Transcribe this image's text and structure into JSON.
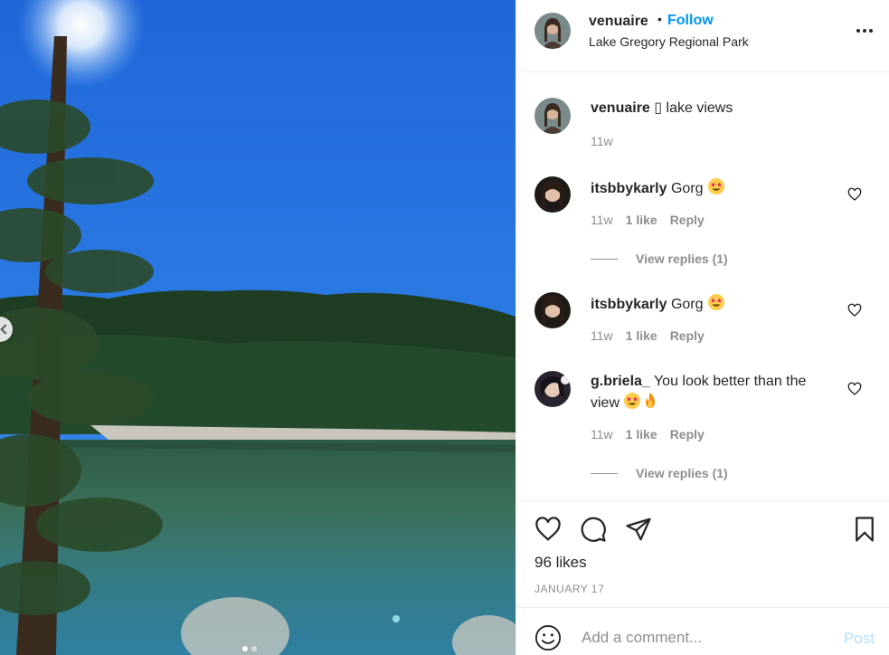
{
  "header": {
    "username": "venuaire",
    "dot": "•",
    "follow_label": "Follow",
    "location": "Lake Gregory Regional Park"
  },
  "caption": {
    "username": "venuaire",
    "emoji_glyph": "▯",
    "text": "lake views",
    "time": "11w"
  },
  "comments": [
    {
      "username": "itsbbykarly",
      "text": "Gorg",
      "emoji": "star-struck",
      "time": "11w",
      "likes": "1 like",
      "reply": "Reply",
      "view_replies": "View replies (1)"
    },
    {
      "username": "itsbbykarly",
      "text": "Gorg",
      "emoji": "star-struck",
      "time": "11w",
      "likes": "1 like",
      "reply": "Reply",
      "view_replies": ""
    },
    {
      "username": "g.briela_",
      "text": "You look better than the view",
      "emoji": "star-struck,fire",
      "time": "11w",
      "likes": "1 like",
      "reply": "Reply",
      "view_replies": "View replies (1)"
    }
  ],
  "actions": {
    "likes": "96 likes",
    "date": "JANUARY 17"
  },
  "add_comment": {
    "placeholder": "Add a comment...",
    "post_label": "Post"
  },
  "carousel": {
    "count": 2,
    "active": 0
  },
  "colors": {
    "accent": "#0095f6",
    "post_disabled": "#b2dffc",
    "muted": "#8e8e8e"
  }
}
